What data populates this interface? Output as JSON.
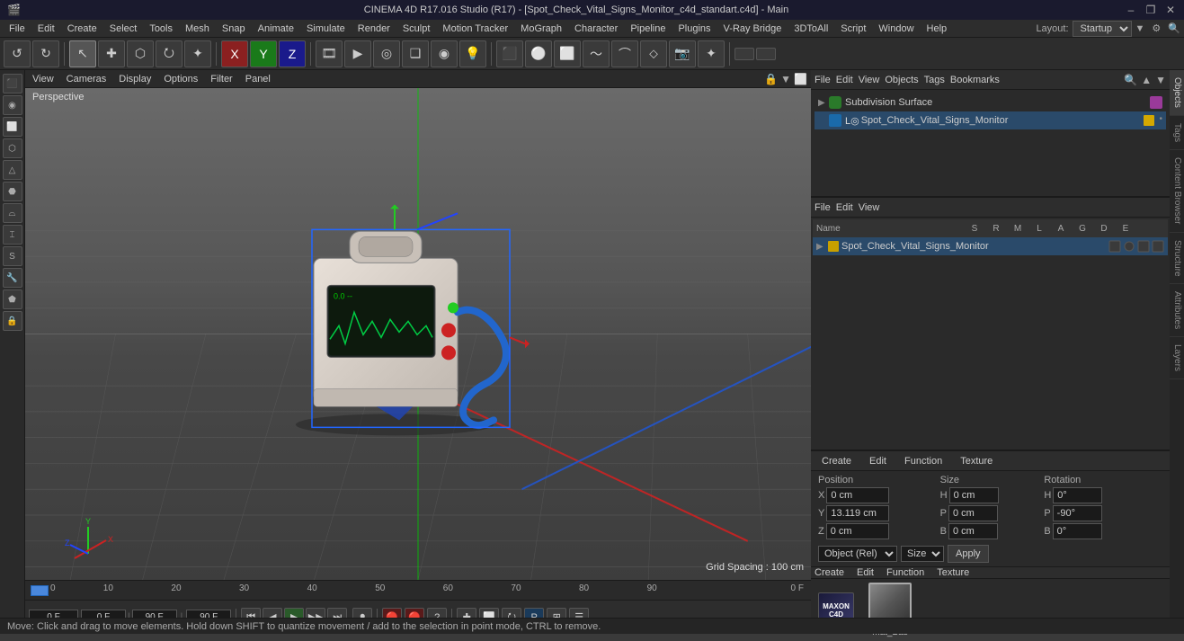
{
  "titlebar": {
    "title": "CINEMA 4D R17.016 Studio (R17) - [Spot_Check_Vital_Signs_Monitor_c4d_standart.c4d] - Main",
    "min": "–",
    "max": "❐",
    "close": "✕"
  },
  "menubar": {
    "items": [
      "File",
      "Edit",
      "Create",
      "Select",
      "Tools",
      "Mesh",
      "Snap",
      "Animate",
      "Simulate",
      "Render",
      "Sculpt",
      "Motion Tracker",
      "MoGraph",
      "Character",
      "Pipeline",
      "Plugins",
      "V-Ray Bridge",
      "3DToAll",
      "Script",
      "Window",
      "Help"
    ],
    "layout_label": "Layout:",
    "layout_value": "Startup"
  },
  "toolbar": {
    "undo_label": "↺",
    "redo_label": "↻",
    "modes": [
      "↖",
      "✚",
      "⬜",
      "⭮",
      "✦"
    ],
    "axes": [
      "X",
      "Y",
      "Z"
    ],
    "more_tools": [
      "⬛",
      "▶",
      "◎",
      "❑",
      "☆",
      "⚙"
    ]
  },
  "viewport": {
    "perspective_label": "Perspective",
    "grid_spacing": "Grid Spacing : 100 cm",
    "menus": [
      "View",
      "Cameras",
      "Display",
      "Options",
      "Filter",
      "Panel"
    ]
  },
  "timeline": {
    "frame_start": "0 F",
    "frame_end": "90 F",
    "frame_end2": "90 F",
    "current_frame": "0 F",
    "preview_start": "0 F",
    "markers": [
      "0",
      "10",
      "20",
      "30",
      "40",
      "50",
      "60",
      "70",
      "80",
      "90",
      "0 F"
    ],
    "playback_buttons": [
      "⏮",
      "◀",
      "▶",
      "▶▶",
      "⏭",
      "⏺"
    ],
    "special_btns": [
      "🔴",
      "🔴",
      "❓",
      "✚",
      "⬜",
      "⭮",
      "⛭",
      "⊞",
      "☰"
    ]
  },
  "obj_manager_top": {
    "toolbar_items": [
      "File",
      "Edit",
      "View",
      "Objects",
      "Tags",
      "Bookmarks"
    ],
    "subdivision_surface": "Subdivision Surface",
    "object_name": "Spot_Check_Vital_Signs_Monitor",
    "tag_color": "#d4a800"
  },
  "obj_manager_bottom": {
    "toolbar_items": [
      "File",
      "Edit",
      "View"
    ],
    "col_headers": [
      "Name",
      "S",
      "R",
      "M",
      "L",
      "A",
      "G",
      "D",
      "E"
    ],
    "object_name": "Spot_Check_Vital_Signs_Monitor"
  },
  "attributes": {
    "tabs": [
      "Create",
      "Edit",
      "Function",
      "Texture"
    ],
    "position": {
      "label": "Position",
      "x_label": "X",
      "x_val": "0 cm",
      "y_label": "Y",
      "y_val": "13.119 cm",
      "z_label": "Z",
      "z_val": "0 cm"
    },
    "size": {
      "label": "Size",
      "h_label": "H",
      "h_val": "0 cm",
      "p_label": "P",
      "p_val": "0 cm",
      "b_label": "B",
      "b_val": "0 cm"
    },
    "rotation": {
      "label": "Rotation",
      "h_val": "0°",
      "p_val": "-90°",
      "b_val": "0°"
    },
    "coord_select": "Object (Rel)",
    "size_select": "Size",
    "apply_btn": "Apply"
  },
  "material_panel": {
    "tabs": [
      "Create",
      "Edit",
      "Function",
      "Texture"
    ],
    "mat_name": "mat_Bas"
  },
  "statusbar": {
    "text": "Move: Click and drag to move elements. Hold down SHIFT to quantize movement / add to the selection in point mode, CTRL to remove."
  },
  "right_tabs": [
    "Objects",
    "Tags",
    "Content Browser",
    "Structure",
    "Attributes",
    "Layers"
  ]
}
